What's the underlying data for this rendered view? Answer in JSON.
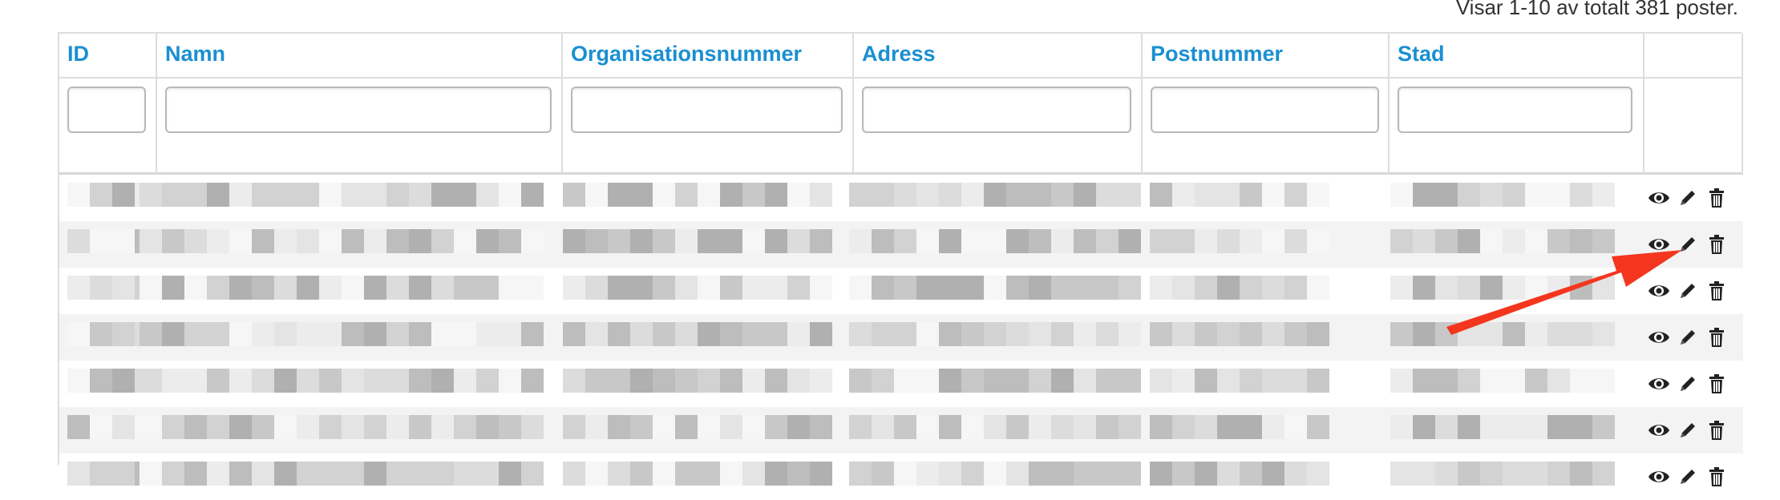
{
  "summary": "Visar 1-10 av totalt 381 poster.",
  "columns": [
    {
      "key": "id",
      "label": "ID"
    },
    {
      "key": "namn",
      "label": "Namn"
    },
    {
      "key": "org",
      "label": "Organisationsnummer"
    },
    {
      "key": "adress",
      "label": "Adress"
    },
    {
      "key": "postnr",
      "label": "Postnummer"
    },
    {
      "key": "stad",
      "label": "Stad"
    },
    {
      "key": "actions",
      "label": ""
    }
  ],
  "filters": {
    "id": "",
    "namn": "",
    "org": "",
    "adress": "",
    "postnr": "",
    "stad": ""
  },
  "rows_visible": 7,
  "row_content": "pixelated / redacted",
  "row_actions": [
    {
      "name": "view-icon",
      "label": "visa"
    },
    {
      "name": "edit-icon",
      "label": "uppdatera"
    },
    {
      "name": "delete-icon",
      "label": "ta bort"
    }
  ],
  "colors": {
    "header_text": "#1a8fd1",
    "annotation_arrow": "#f4361e",
    "stripe": "#f3f3f3",
    "border": "#dddddd"
  }
}
